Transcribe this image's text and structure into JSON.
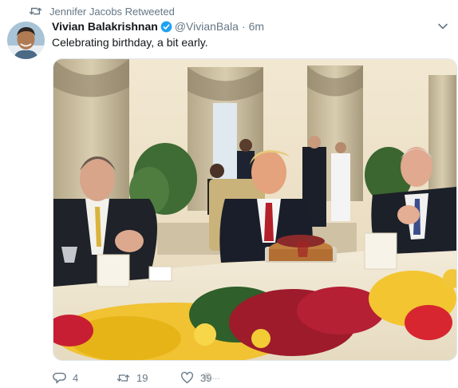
{
  "retweet_notice": {
    "text": "Jennifer Jacobs Retweeted",
    "icon": "retweet-icon"
  },
  "tweet": {
    "author": {
      "display_name": "Vivian Balakrishnan",
      "handle": "@VivianBala",
      "verified": true,
      "avatar": "user-avatar"
    },
    "time": "6m",
    "separator": "·",
    "text": "Celebrating birthday, a bit early.",
    "media": {
      "type": "photo"
    },
    "actions": {
      "reply": {
        "icon": "reply-icon",
        "count": "4"
      },
      "retweet": {
        "icon": "retweet-icon",
        "count": "19"
      },
      "like": {
        "icon": "heart-icon",
        "count": "39"
      }
    }
  },
  "watermark": "@…",
  "colors": {
    "verified_blue": "#1da1f2",
    "meta_gray": "#657786",
    "text": "#14171a"
  }
}
